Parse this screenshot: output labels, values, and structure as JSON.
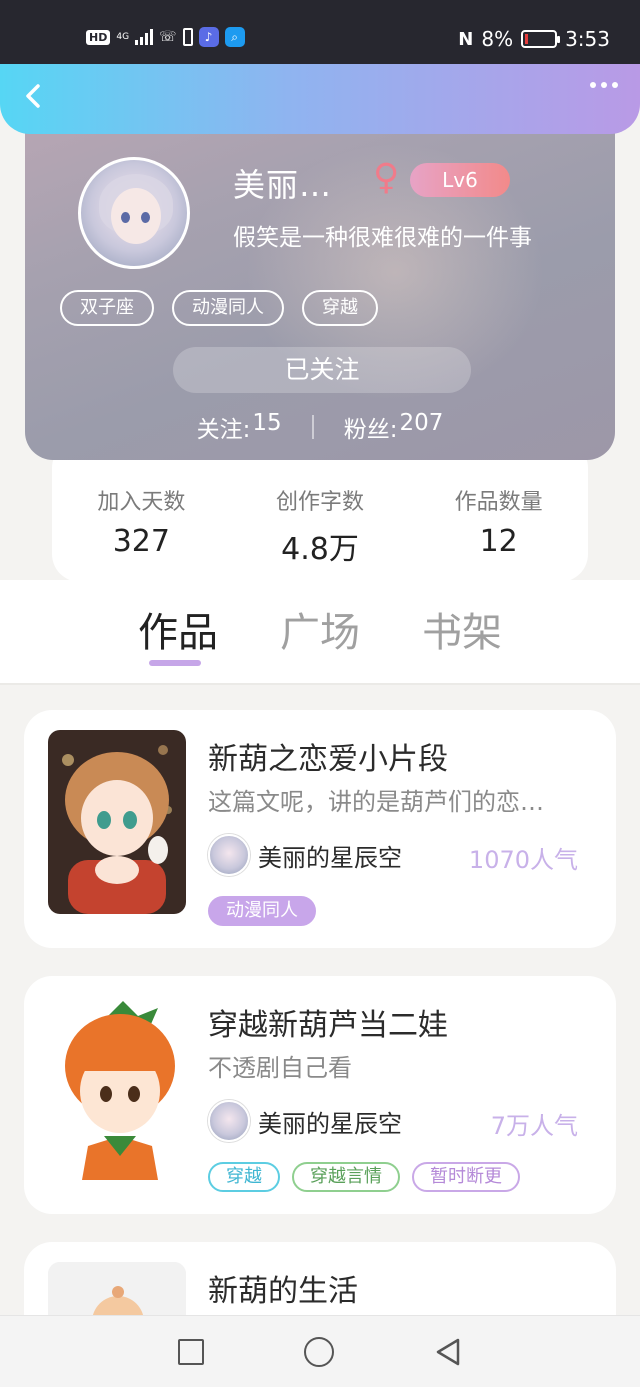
{
  "status_bar": {
    "hd": "HD",
    "signal": "4G",
    "battery_percent": "8%",
    "time": "3:53",
    "nfc": "N"
  },
  "nav": {
    "back_icon": "chevron-left-icon",
    "more_icon": "more-dots-icon"
  },
  "profile": {
    "name": "美丽…",
    "gender_symbol": "♀",
    "level": "Lv6",
    "signature": "假笑是一种很难很难的一件事",
    "tags": [
      "双子座",
      "动漫同人",
      "穿越"
    ],
    "follow_button": "已关注",
    "following_label": "关注:",
    "following_count": "15",
    "fans_label": "粉丝:",
    "fans_count": "207"
  },
  "summary": [
    {
      "label": "加入天数",
      "value": "327"
    },
    {
      "label": "创作字数",
      "value": "4.8万"
    },
    {
      "label": "作品数量",
      "value": "12"
    }
  ],
  "tabs": [
    {
      "label": "作品",
      "active": true
    },
    {
      "label": "广场",
      "active": false
    },
    {
      "label": "书架",
      "active": false
    }
  ],
  "works": [
    {
      "title": "新葫之恋爱小片段",
      "description": "这篇文呢，讲的是葫芦们的恋…",
      "author": "美丽的星辰空",
      "popularity": "1070人气",
      "tags": [
        "动漫同人"
      ]
    },
    {
      "title": "穿越新葫芦当二娃",
      "description": "不透剧自己看",
      "author": "美丽的星辰空",
      "popularity": "7万人气",
      "tags": [
        "穿越",
        "穿越言情",
        "暂时断更"
      ]
    },
    {
      "title": "新葫的生活"
    }
  ],
  "colors": {
    "accent": "#c6a6e8",
    "popularity": "#c8b1e9",
    "gender": "#f07b8a"
  }
}
